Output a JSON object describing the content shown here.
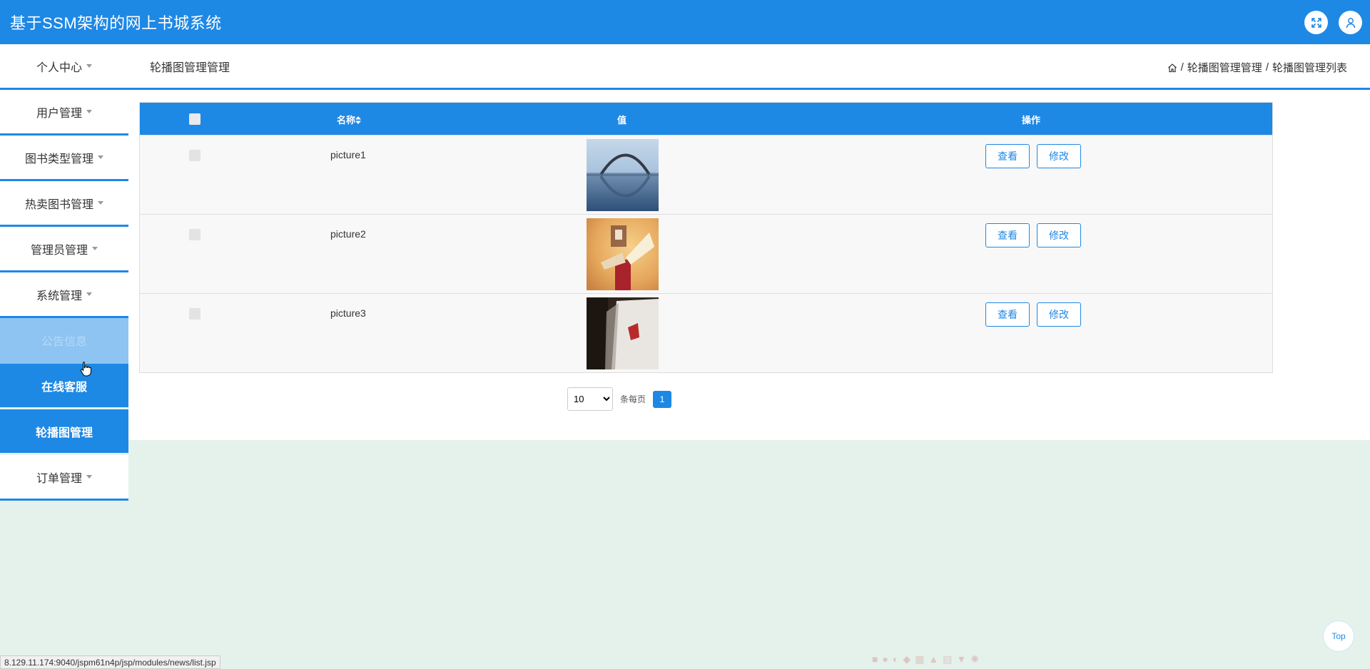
{
  "header": {
    "title": "基于SSM架构的网上书城系统",
    "fullscreen_icon": "expand-icon",
    "user_icon": "user-icon"
  },
  "sidebar": {
    "items": [
      {
        "label": "个人中心",
        "dropdown": true
      },
      {
        "label": "用户管理",
        "dropdown": true
      },
      {
        "label": "图书类型管理",
        "dropdown": true
      },
      {
        "label": "热卖图书管理",
        "dropdown": true
      },
      {
        "label": "管理员管理",
        "dropdown": true
      },
      {
        "label": "系统管理",
        "dropdown": true
      },
      {
        "label": "公告信息",
        "dropdown": false
      },
      {
        "label": "在线客服",
        "dropdown": false
      },
      {
        "label": "轮播图管理",
        "dropdown": false
      },
      {
        "label": "订单管理",
        "dropdown": true
      }
    ]
  },
  "page": {
    "title": "轮播图管理管理",
    "breadcrumb": {
      "home_icon": "home-icon",
      "sep": "/",
      "level1": "轮播图管理管理",
      "level2": "轮播图管理列表"
    }
  },
  "table": {
    "columns": {
      "name": "名称",
      "sort_icon": "sort-icon",
      "value": "值",
      "actions": "操作"
    },
    "rows": [
      {
        "name": "picture1",
        "image": "bridge-reflection"
      },
      {
        "name": "picture2",
        "image": "open-book"
      },
      {
        "name": "picture3",
        "image": "dark-book"
      }
    ],
    "view_label": "查看",
    "edit_label": "修改"
  },
  "pagination": {
    "page_size": "10",
    "page_size_options": [
      "10"
    ],
    "per_page_label": "条每页",
    "current_page": "1"
  },
  "status_url": "8.129.11.174:9040/jspm61n4p/jsp/modules/news/list.jsp",
  "top_button": "Top",
  "colors": {
    "primary": "#1e88e5",
    "background": "#e5f2ec",
    "faded_item": "#8ec4f2"
  }
}
